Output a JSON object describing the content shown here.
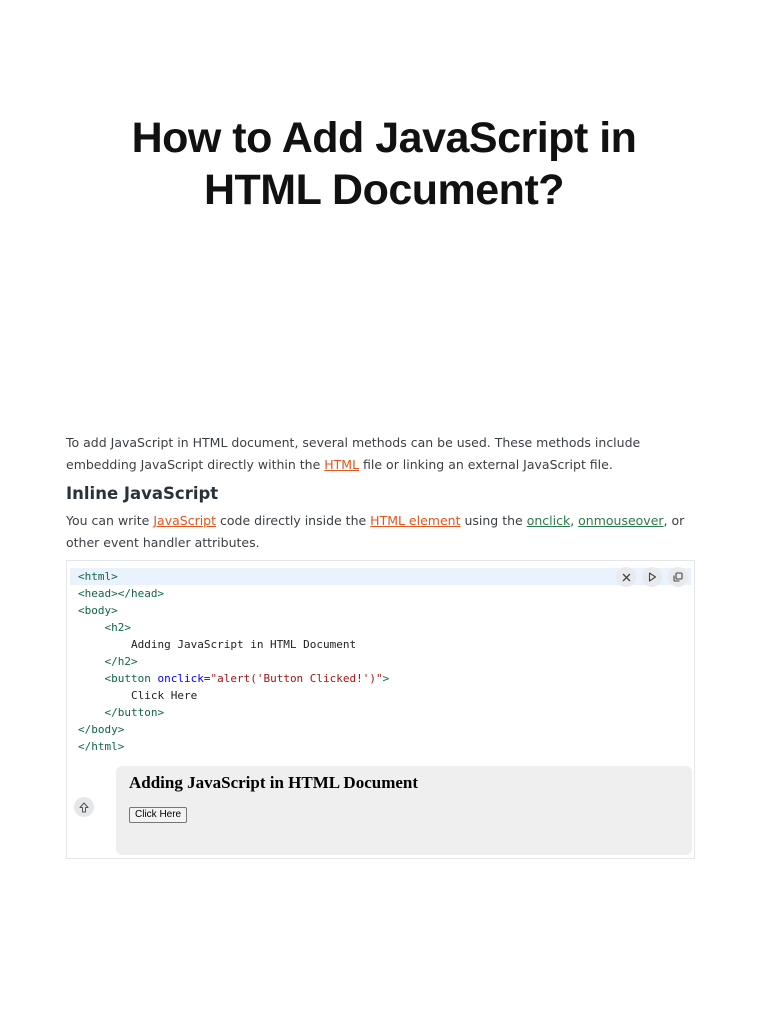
{
  "article": {
    "title_line1": "How to Add JavaScript in",
    "title_line2": "HTML Document?",
    "intro": {
      "part1": "To add JavaScript in HTML document, several methods can be used. These methods include embedding JavaScript directly within the ",
      "link_html": "HTML",
      "part2": " file or linking an external JavaScript file."
    },
    "section": {
      "heading": "Inline JavaScript",
      "text1": "You can write ",
      "link_javascript": "JavaScript",
      "text2": " code directly inside the ",
      "link_html_element": "HTML element",
      "text3": " using the ",
      "link_onclick": "onclick",
      "text4": ", ",
      "link_onmouseover": "onmouseover",
      "text5": ", or other event handler attributes."
    }
  },
  "code": {
    "lines": [
      {
        "indent": "",
        "tag": "<html>"
      },
      {
        "indent": "",
        "tag": "<head></head>"
      },
      {
        "indent": "",
        "tag": "<body>"
      },
      {
        "indent": "    ",
        "tag": "<h2>"
      },
      {
        "indent": "        ",
        "text": "Adding JavaScript in HTML Document"
      },
      {
        "indent": "    ",
        "tag": "</h2>"
      },
      {
        "indent": "    ",
        "tag_open": "<button ",
        "attr": "onclick",
        "eq": "=",
        "str": "\"alert('Button Clicked!')\"",
        "tag_close": ">"
      },
      {
        "indent": "        ",
        "text": "Click Here"
      },
      {
        "indent": "    ",
        "tag": "</button>"
      },
      {
        "indent": "",
        "tag": "</body>"
      },
      {
        "indent": "",
        "tag": "</html>"
      }
    ],
    "actions": [
      "close-icon",
      "play-icon",
      "copy-icon"
    ]
  },
  "output": {
    "heading": "Adding JavaScript in HTML Document",
    "button_label": "Click Here"
  },
  "colors": {
    "link_orange": "#e2551c",
    "link_green": "#2c7a4b",
    "code_tag": "#116644",
    "code_attr": "#0000ff",
    "code_string": "#a31515",
    "highlight": "#e9f2fd"
  }
}
